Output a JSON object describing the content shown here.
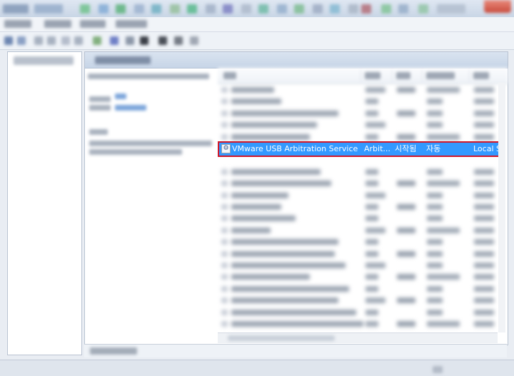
{
  "selected_service": {
    "name": "VMware USB Arbitration Service",
    "description": "Arbit...",
    "status": "시작됨",
    "startup_type": "자동",
    "log_on_as": "Local S"
  },
  "colors": {
    "selection": "#3399ff",
    "highlight_box": "#d0182a",
    "close_button": "#c94a3b"
  },
  "icons": {
    "service": "service-gear-icon"
  }
}
